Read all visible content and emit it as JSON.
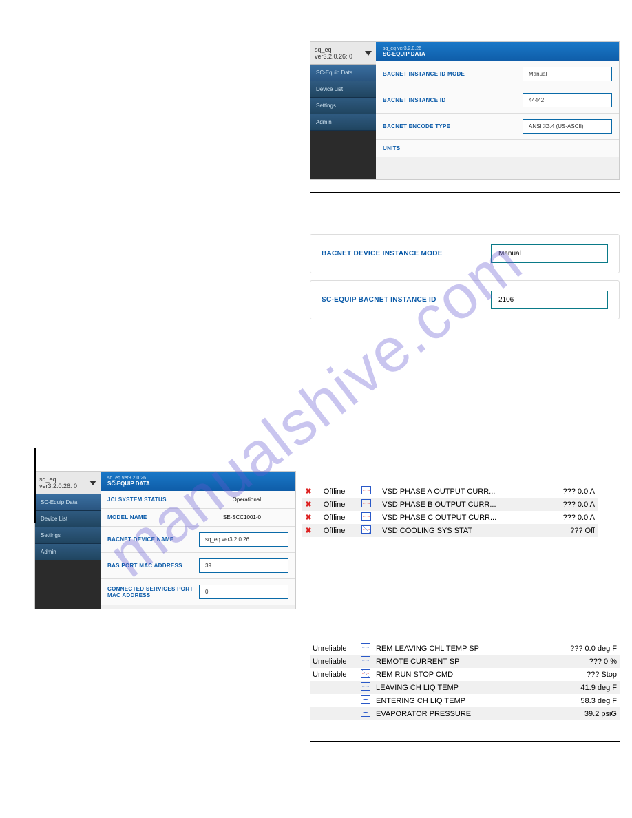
{
  "watermark": "manualshive.com",
  "shot1": {
    "sidebar_top": "sq_eq ver3.2.0.26: 0",
    "sidebar_items": [
      "SC-Equip Data",
      "Device List",
      "Settings",
      "Admin"
    ],
    "header_sub": "sq_eq ver3.2.0.26",
    "header_title": "SC-EQUIP DATA",
    "rows": [
      {
        "label": "BACNET INSTANCE ID MODE",
        "value": "Manual"
      },
      {
        "label": "BACNET INSTANCE ID",
        "value": "44442"
      },
      {
        "label": "BACNET ENCODE TYPE",
        "value": "ANSI X3.4 (US-ASCII)"
      },
      {
        "label": "UNITS",
        "value": ""
      }
    ]
  },
  "fields": [
    {
      "label": "BACNET DEVICE INSTANCE MODE",
      "value": "Manual"
    },
    {
      "label": "SC-EQUIP BACNET INSTANCE ID",
      "value": "2106"
    }
  ],
  "shot2": {
    "sidebar_top": "sq_eq ver3.2.0.26: 0",
    "sidebar_items": [
      "SC-Equip Data",
      "Device List",
      "Settings",
      "Admin"
    ],
    "header_sub": "sq_eq ver3.2.0.26",
    "header_title": "SC-EQUIP DATA",
    "rows": [
      {
        "label": "JCI SYSTEM STATUS",
        "value": "Operational"
      },
      {
        "label": "MODEL NAME",
        "value": "SE-SCC1001-0"
      },
      {
        "label": "BACNET DEVICE NAME",
        "value": "sq_eq ver3.2.0.26"
      },
      {
        "label": "BAS PORT MAC ADDRESS",
        "value": "39"
      },
      {
        "label": "CONNECTED SERVICES PORT MAC ADDRESS",
        "value": "0"
      }
    ]
  },
  "offline_points": [
    {
      "status": "Offline",
      "name": "VSD PHASE A OUTPUT CURR...",
      "val": "??? 0.0 A"
    },
    {
      "status": "Offline",
      "name": "VSD PHASE B OUTPUT CURR...",
      "val": "??? 0.0 A"
    },
    {
      "status": "Offline",
      "name": "VSD PHASE C OUTPUT CURR...",
      "val": "??? 0.0 A"
    },
    {
      "status": "Offline",
      "name": "VSD COOLING SYS STAT",
      "val": "??? Off"
    }
  ],
  "unreliable_points": [
    {
      "status": "Unreliable",
      "icon": "wave",
      "name": "REM LEAVING CHL TEMP SP",
      "val": "??? 0.0 deg F"
    },
    {
      "status": "Unreliable",
      "icon": "wave",
      "name": "REMOTE CURRENT SP",
      "val": "??? 0 %"
    },
    {
      "status": "Unreliable",
      "icon": "slash",
      "name": "REM RUN STOP CMD",
      "val": "??? Stop"
    },
    {
      "status": "",
      "icon": "wave",
      "name": "LEAVING CH LIQ TEMP",
      "val": "41.9 deg F"
    },
    {
      "status": "",
      "icon": "wave",
      "name": "ENTERING CH LIQ TEMP",
      "val": "58.3 deg F"
    },
    {
      "status": "",
      "icon": "wave",
      "name": "EVAPORATOR PRESSURE",
      "val": "39.2 psiG"
    }
  ]
}
